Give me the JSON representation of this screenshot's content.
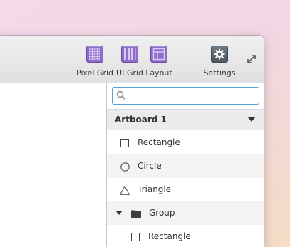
{
  "toolbar": {
    "pixel_grid_label": "Pixel Grid",
    "ui_grid_label": "UI Grid",
    "layout_label": "Layout",
    "settings_label": "Settings"
  },
  "search": {
    "value": "",
    "placeholder": ""
  },
  "artboard": {
    "title": "Artboard 1"
  },
  "layers": [
    {
      "label": "Rectangle",
      "icon": "square-icon"
    },
    {
      "label": "Circle",
      "icon": "circle-icon"
    },
    {
      "label": "Triangle",
      "icon": "triangle-icon"
    },
    {
      "label": "Group",
      "icon": "folder-icon"
    },
    {
      "label": "Rectangle",
      "icon": "square-icon"
    }
  ],
  "colors": {
    "tool_accent": "#8e6cc9",
    "search_focus": "#5aa1d6"
  }
}
